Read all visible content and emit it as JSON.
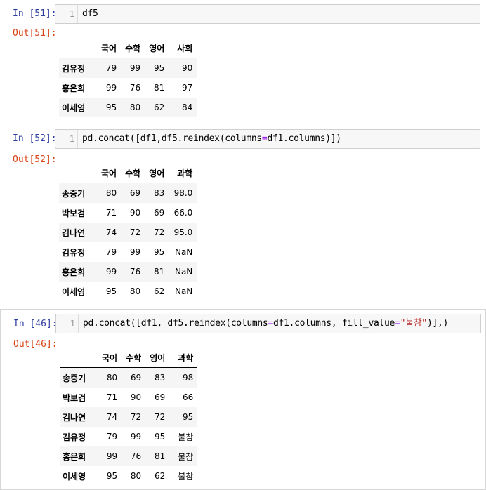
{
  "cells": [
    {
      "in_prompt": "In [51]:",
      "out_prompt": "Out[51]:",
      "line_no": "1",
      "code": "df5",
      "table": {
        "columns": [
          "",
          "국어",
          "수학",
          "영어",
          "사회"
        ],
        "rows": [
          [
            "김유정",
            "79",
            "99",
            "95",
            "90"
          ],
          [
            "홍은희",
            "99",
            "76",
            "81",
            "97"
          ],
          [
            "이세영",
            "95",
            "80",
            "62",
            "84"
          ]
        ]
      }
    },
    {
      "in_prompt": "In [52]:",
      "out_prompt": "Out[52]:",
      "line_no": "1",
      "code_parts": [
        "pd.concat([df1,df5.reindex(columns",
        "=",
        "df1.columns)])"
      ],
      "table": {
        "columns": [
          "",
          "국어",
          "수학",
          "영어",
          "과학"
        ],
        "rows": [
          [
            "송중기",
            "80",
            "69",
            "83",
            "98.0"
          ],
          [
            "박보검",
            "71",
            "90",
            "69",
            "66.0"
          ],
          [
            "김나연",
            "74",
            "72",
            "72",
            "95.0"
          ],
          [
            "김유정",
            "79",
            "99",
            "95",
            "NaN"
          ],
          [
            "홍은희",
            "99",
            "76",
            "81",
            "NaN"
          ],
          [
            "이세영",
            "95",
            "80",
            "62",
            "NaN"
          ]
        ]
      }
    },
    {
      "in_prompt": "In [46]:",
      "out_prompt": "Out[46]:",
      "line_no": "1",
      "code_parts": [
        "pd.concat([df1, df5.reindex(columns",
        "=",
        "df1.columns, fill_value",
        "=",
        "\"불참\"",
        ")],)"
      ],
      "table": {
        "columns": [
          "",
          "국어",
          "수학",
          "영어",
          "과학"
        ],
        "rows": [
          [
            "송중기",
            "80",
            "69",
            "83",
            "98"
          ],
          [
            "박보검",
            "71",
            "90",
            "69",
            "66"
          ],
          [
            "김나연",
            "74",
            "72",
            "72",
            "95"
          ],
          [
            "김유정",
            "79",
            "99",
            "95",
            "불참"
          ],
          [
            "홍은희",
            "99",
            "76",
            "81",
            "불참"
          ],
          [
            "이세영",
            "95",
            "80",
            "62",
            "불참"
          ]
        ]
      }
    }
  ]
}
